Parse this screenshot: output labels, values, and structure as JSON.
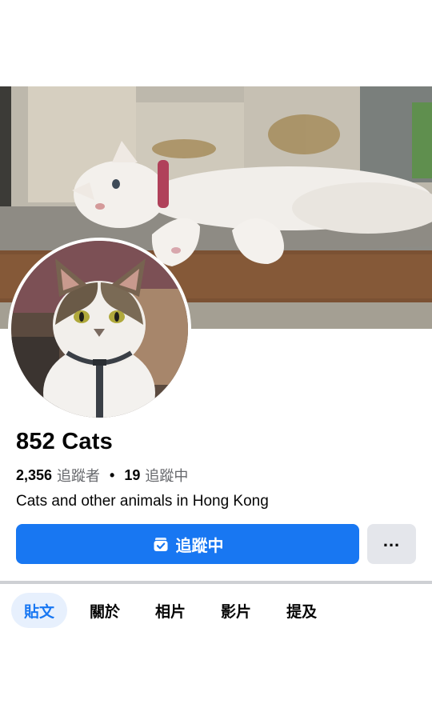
{
  "profile": {
    "name": "852 Cats",
    "followers_count": "2,356",
    "followers_label": "追蹤者",
    "separator": "•",
    "following_count": "19",
    "following_label": "追蹤中",
    "bio": "Cats and other animals in Hong Kong"
  },
  "actions": {
    "follow_label": "追蹤中",
    "more_label": "..."
  },
  "tabs": [
    {
      "label": "貼文",
      "active": true
    },
    {
      "label": "關於",
      "active": false
    },
    {
      "label": "相片",
      "active": false
    },
    {
      "label": "影片",
      "active": false
    },
    {
      "label": "提及",
      "active": false
    }
  ],
  "colors": {
    "accent": "#1877f2",
    "secondary_button": "#e4e6eb",
    "active_tab_bg": "#e7f0fd",
    "muted_text": "#65676b"
  },
  "icons": {
    "follow": "following-check-icon",
    "more": "more-dots-icon"
  }
}
